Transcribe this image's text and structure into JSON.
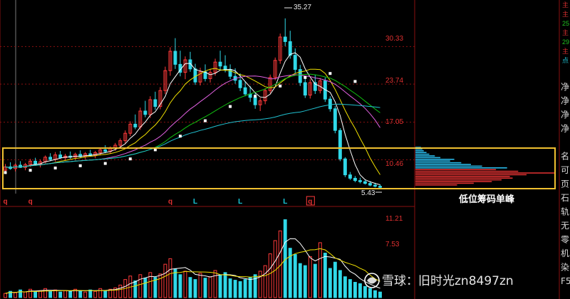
{
  "chart_data": {
    "type": "candlestick",
    "price_axis": {
      "ticks": [
        "30.33",
        "23.74",
        "17.05",
        "10.46"
      ],
      "tick_values": [
        30.33,
        23.74,
        17.05,
        10.46
      ],
      "ylim": [
        4.5,
        37.5
      ]
    },
    "price_high_label": "35.27",
    "price_high_value": 35.27,
    "price_low_label": "5.43",
    "price_low_value": 5.43,
    "candles": [
      {
        "o": 8.6,
        "h": 9.7,
        "l": 8.1,
        "c": 9.2
      },
      {
        "o": 9.2,
        "h": 10.0,
        "l": 8.7,
        "c": 8.9
      },
      {
        "o": 8.9,
        "h": 9.8,
        "l": 8.4,
        "c": 9.5
      },
      {
        "o": 9.5,
        "h": 10.2,
        "l": 9.0,
        "c": 9.1
      },
      {
        "o": 9.1,
        "h": 9.9,
        "l": 8.6,
        "c": 9.6
      },
      {
        "o": 9.6,
        "h": 10.6,
        "l": 9.2,
        "c": 10.2
      },
      {
        "o": 10.2,
        "h": 10.8,
        "l": 9.4,
        "c": 9.7
      },
      {
        "o": 9.7,
        "h": 10.5,
        "l": 9.1,
        "c": 10.1
      },
      {
        "o": 10.1,
        "h": 11.2,
        "l": 9.8,
        "c": 10.9
      },
      {
        "o": 10.9,
        "h": 11.6,
        "l": 10.2,
        "c": 10.5
      },
      {
        "o": 10.5,
        "h": 11.8,
        "l": 10.1,
        "c": 11.3
      },
      {
        "o": 11.3,
        "h": 12.0,
        "l": 10.6,
        "c": 10.8
      },
      {
        "o": 10.8,
        "h": 11.5,
        "l": 10.3,
        "c": 11.1
      },
      {
        "o": 11.1,
        "h": 11.9,
        "l": 10.6,
        "c": 10.9
      },
      {
        "o": 10.9,
        "h": 11.7,
        "l": 10.4,
        "c": 11.4
      },
      {
        "o": 11.4,
        "h": 12.1,
        "l": 10.8,
        "c": 11.0
      },
      {
        "o": 11.0,
        "h": 11.8,
        "l": 10.5,
        "c": 11.5
      },
      {
        "o": 11.5,
        "h": 12.2,
        "l": 11.0,
        "c": 11.2
      },
      {
        "o": 11.2,
        "h": 12.0,
        "l": 10.7,
        "c": 11.7
      },
      {
        "o": 11.7,
        "h": 12.6,
        "l": 11.2,
        "c": 12.2
      },
      {
        "o": 12.2,
        "h": 13.0,
        "l": 11.6,
        "c": 11.9
      },
      {
        "o": 11.9,
        "h": 12.8,
        "l": 11.5,
        "c": 12.5
      },
      {
        "o": 12.5,
        "h": 13.4,
        "l": 12.0,
        "c": 13.0
      },
      {
        "o": 13.0,
        "h": 14.2,
        "l": 12.5,
        "c": 13.8
      },
      {
        "o": 13.8,
        "h": 15.6,
        "l": 13.2,
        "c": 15.1
      },
      {
        "o": 15.1,
        "h": 17.2,
        "l": 14.6,
        "c": 16.7
      },
      {
        "o": 16.7,
        "h": 18.4,
        "l": 15.8,
        "c": 16.2
      },
      {
        "o": 16.2,
        "h": 19.6,
        "l": 15.7,
        "c": 19.0
      },
      {
        "o": 19.0,
        "h": 20.8,
        "l": 17.9,
        "c": 18.4
      },
      {
        "o": 18.4,
        "h": 21.6,
        "l": 17.8,
        "c": 21.0
      },
      {
        "o": 21.0,
        "h": 22.4,
        "l": 19.2,
        "c": 19.8
      },
      {
        "o": 19.8,
        "h": 23.2,
        "l": 19.3,
        "c": 22.6
      },
      {
        "o": 22.6,
        "h": 26.8,
        "l": 22.0,
        "c": 26.1
      },
      {
        "o": 26.1,
        "h": 30.2,
        "l": 25.2,
        "c": 29.5
      },
      {
        "o": 29.5,
        "h": 31.8,
        "l": 26.4,
        "c": 27.2
      },
      {
        "o": 27.2,
        "h": 29.6,
        "l": 25.1,
        "c": 25.8
      },
      {
        "o": 25.8,
        "h": 28.6,
        "l": 24.6,
        "c": 28.0
      },
      {
        "o": 28.0,
        "h": 29.4,
        "l": 25.9,
        "c": 26.4
      },
      {
        "o": 26.4,
        "h": 27.3,
        "l": 23.6,
        "c": 24.1
      },
      {
        "o": 24.1,
        "h": 26.6,
        "l": 23.5,
        "c": 25.9
      },
      {
        "o": 25.9,
        "h": 27.2,
        "l": 24.2,
        "c": 24.7
      },
      {
        "o": 24.7,
        "h": 26.4,
        "l": 24.0,
        "c": 25.8
      },
      {
        "o": 25.8,
        "h": 28.2,
        "l": 25.2,
        "c": 27.6
      },
      {
        "o": 27.6,
        "h": 29.6,
        "l": 26.1,
        "c": 26.9
      },
      {
        "o": 26.9,
        "h": 28.8,
        "l": 25.8,
        "c": 26.3
      },
      {
        "o": 26.3,
        "h": 27.2,
        "l": 24.6,
        "c": 25.1
      },
      {
        "o": 25.1,
        "h": 26.5,
        "l": 23.8,
        "c": 24.4
      },
      {
        "o": 24.4,
        "h": 25.6,
        "l": 22.5,
        "c": 23.1
      },
      {
        "o": 23.1,
        "h": 24.2,
        "l": 21.6,
        "c": 22.0
      },
      {
        "o": 22.0,
        "h": 23.4,
        "l": 20.6,
        "c": 21.4
      },
      {
        "o": 21.4,
        "h": 22.2,
        "l": 19.4,
        "c": 20.1
      },
      {
        "o": 20.1,
        "h": 21.3,
        "l": 19.0,
        "c": 20.8
      },
      {
        "o": 20.8,
        "h": 23.0,
        "l": 20.2,
        "c": 22.6
      },
      {
        "o": 22.6,
        "h": 25.4,
        "l": 22.1,
        "c": 24.9
      },
      {
        "o": 24.9,
        "h": 28.4,
        "l": 24.4,
        "c": 27.9
      },
      {
        "o": 27.9,
        "h": 32.6,
        "l": 27.3,
        "c": 32.0
      },
      {
        "o": 32.0,
        "h": 35.27,
        "l": 30.4,
        "c": 31.2
      },
      {
        "o": 31.2,
        "h": 33.1,
        "l": 28.2,
        "c": 28.8
      },
      {
        "o": 28.8,
        "h": 30.0,
        "l": 25.6,
        "c": 26.3
      },
      {
        "o": 26.3,
        "h": 27.1,
        "l": 23.4,
        "c": 24.0
      },
      {
        "o": 24.0,
        "h": 25.2,
        "l": 21.3,
        "c": 21.8
      },
      {
        "o": 21.8,
        "h": 24.6,
        "l": 21.2,
        "c": 24.0
      },
      {
        "o": 24.0,
        "h": 25.3,
        "l": 22.0,
        "c": 22.6
      },
      {
        "o": 22.6,
        "h": 24.8,
        "l": 22.1,
        "c": 24.3
      },
      {
        "o": 24.3,
        "h": 24.9,
        "l": 20.6,
        "c": 21.1
      },
      {
        "o": 21.1,
        "h": 21.6,
        "l": 18.9,
        "c": 19.4
      },
      {
        "o": 19.4,
        "h": 19.9,
        "l": 15.1,
        "c": 15.6
      },
      {
        "o": 15.6,
        "h": 16.0,
        "l": 10.2,
        "c": 10.6
      },
      {
        "o": 10.6,
        "h": 10.9,
        "l": 7.4,
        "c": 7.8
      },
      {
        "o": 7.8,
        "h": 8.3,
        "l": 6.9,
        "c": 7.2
      },
      {
        "o": 7.2,
        "h": 7.6,
        "l": 6.5,
        "c": 6.8
      },
      {
        "o": 6.8,
        "h": 7.3,
        "l": 6.3,
        "c": 6.6
      },
      {
        "o": 6.6,
        "h": 7.0,
        "l": 6.1,
        "c": 6.3
      },
      {
        "o": 6.3,
        "h": 6.7,
        "l": 5.8,
        "c": 6.0
      },
      {
        "o": 6.0,
        "h": 6.4,
        "l": 5.6,
        "c": 5.8
      },
      {
        "o": 5.8,
        "h": 6.1,
        "l": 5.43,
        "c": 5.6
      }
    ],
    "moving_averages": [
      {
        "color": "#ffffff",
        "period": 5
      },
      {
        "color": "#f0e000",
        "period": 10
      },
      {
        "color": "#e060e0",
        "period": 20
      },
      {
        "color": "#10c010",
        "period": 30
      },
      {
        "color": "#20c0d0",
        "period": 60
      }
    ],
    "long_average_dots": [
      [
        0,
        8.2
      ],
      [
        5,
        8.6
      ],
      [
        10,
        9.0
      ],
      [
        15,
        9.4
      ],
      [
        20,
        9.8
      ],
      [
        25,
        10.6
      ],
      [
        30,
        12.2
      ],
      [
        35,
        14.6
      ],
      [
        40,
        17.3
      ],
      [
        45,
        19.8
      ],
      [
        50,
        21.6
      ],
      [
        55,
        23.4
      ],
      [
        60,
        24.9
      ],
      [
        65,
        25.6
      ],
      [
        70,
        24.2
      ]
    ],
    "chip_distribution": {
      "levels": [
        6.0,
        6.3,
        6.6,
        6.9,
        7.2,
        7.5,
        7.8,
        8.1,
        8.4,
        8.7,
        9.0,
        9.3,
        9.6,
        9.9,
        10.2,
        10.5,
        10.8,
        11.1,
        11.4,
        11.7,
        12.0,
        12.3,
        12.6
      ],
      "widths": [
        0.3,
        0.42,
        0.55,
        0.62,
        0.7,
        0.68,
        0.8,
        1.0,
        0.74,
        0.58,
        0.66,
        0.48,
        0.4,
        0.33,
        0.25,
        0.28,
        0.18,
        0.14,
        0.1,
        0.08,
        0.06,
        0.05,
        0.04
      ],
      "below_price_color": "#d83030",
      "above_price_color": "#28b8e8"
    },
    "markers": [
      {
        "label": "q",
        "index": 0
      },
      {
        "label": "q",
        "index": 5
      },
      {
        "label": "q",
        "index": 33
      },
      {
        "label": "L",
        "index": 38
      },
      {
        "label": "L",
        "index": 47
      },
      {
        "label": "L",
        "index": 56
      },
      {
        "label": "q",
        "index": 61
      }
    ],
    "volume_axis": {
      "ticks": [
        "11.21",
        "7.53"
      ],
      "tick_values": [
        11.21,
        7.53
      ],
      "ylim": [
        0,
        12.5
      ]
    },
    "volume": [
      0.6,
      0.9,
      0.7,
      1.1,
      0.8,
      1.2,
      0.9,
      1.0,
      1.3,
      0.9,
      1.1,
      0.8,
      1.0,
      0.9,
      1.2,
      1.0,
      0.8,
      1.1,
      0.9,
      1.3,
      1.0,
      1.2,
      1.4,
      1.8,
      2.6,
      3.1,
      2.4,
      3.3,
      2.8,
      3.6,
      2.9,
      3.4,
      4.8,
      5.6,
      4.1,
      3.3,
      3.8,
      2.9,
      2.6,
      3.5,
      2.8,
      3.0,
      3.9,
      3.2,
      3.6,
      2.7,
      2.5,
      2.3,
      2.6,
      2.9,
      3.3,
      3.8,
      4.6,
      6.3,
      8.2,
      9.6,
      11.21,
      7.1,
      6.2,
      4.9,
      4.6,
      5.9,
      4.8,
      7.9,
      6.4,
      4.2,
      5.1,
      3.9,
      3.0,
      2.6,
      2.2,
      2.0,
      1.6,
      1.3,
      1.0,
      0.8
    ],
    "highlight_annotation": "低位筹码单峰"
  },
  "side_panel": {
    "top_rows": [
      {
        "text": "主",
        "color": "#d83030"
      },
      {
        "text": "主",
        "color": "#d83030"
      },
      {
        "text": "25",
        "color": "#20c020"
      },
      {
        "text": "主",
        "color": "#d83030"
      },
      {
        "text": "29",
        "color": "#20c020"
      },
      {
        "text": "主",
        "color": "#d83030"
      },
      {
        "text": "点",
        "color": "#20c0d0"
      }
    ],
    "rows": [
      "净",
      "净",
      "净",
      "净",
      "",
      "名",
      "可",
      "页",
      "石",
      "轨",
      "无",
      "零",
      "机",
      "染",
      "F5"
    ]
  },
  "watermark": {
    "brand": "雪球",
    "separator": "：",
    "author": "旧时光zn8497zn"
  },
  "colors": {
    "up": "#ff3a3a",
    "down": "#30d8e8",
    "highlight_box": "#f0c030",
    "grid": "#8a1010"
  }
}
